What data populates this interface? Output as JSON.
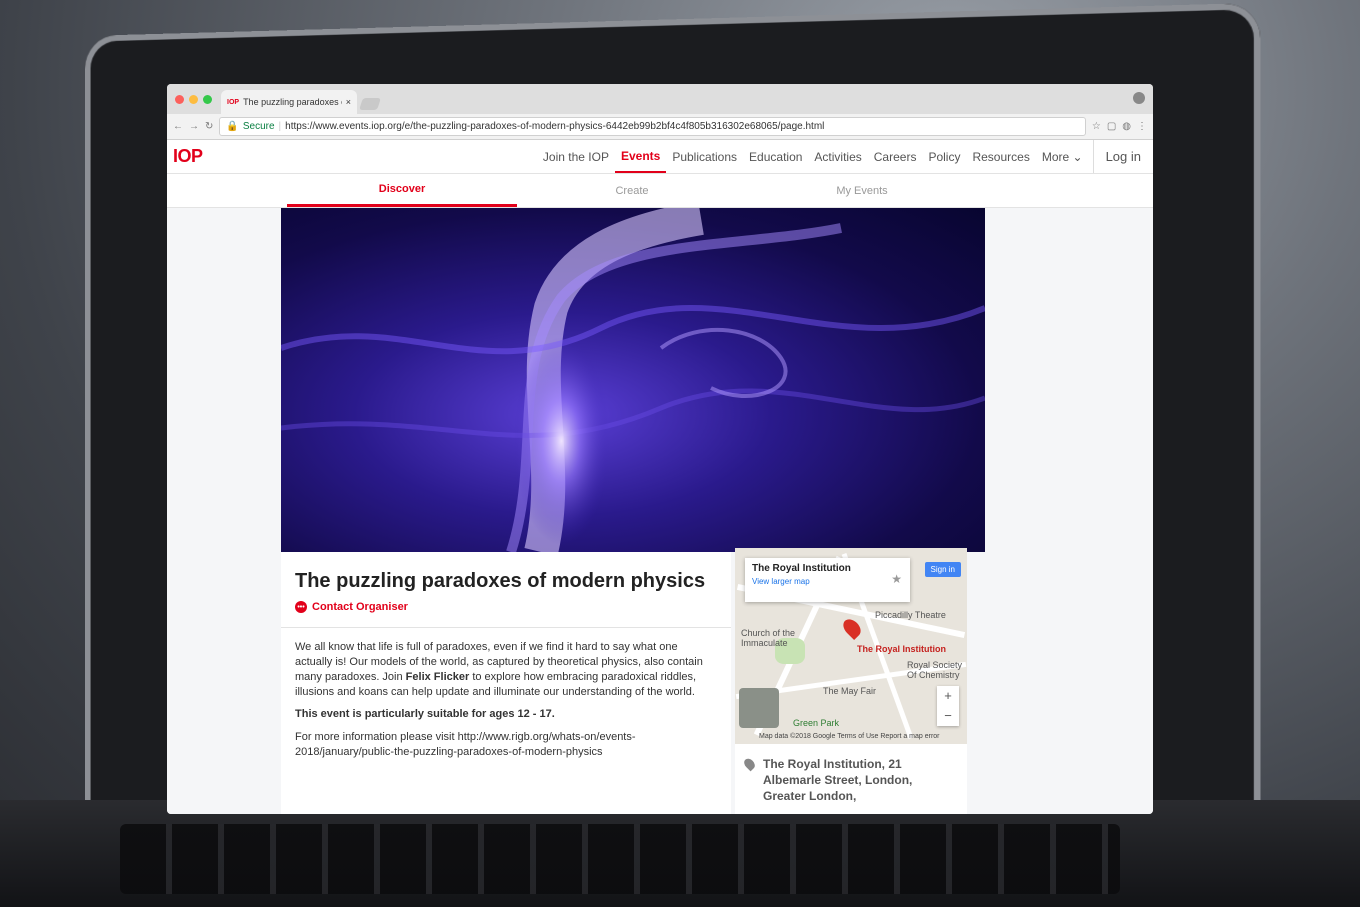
{
  "browser": {
    "tab_title": "The puzzling paradoxes of mo",
    "secure_label": "Secure",
    "url": "https://www.events.iop.org/e/the-puzzling-paradoxes-of-modern-physics-6442eb99b2bf4c4f805b316302e68065/page.html"
  },
  "header": {
    "logo": "IOP",
    "nav": [
      "Join the IOP",
      "Events",
      "Publications",
      "Education",
      "Activities",
      "Careers",
      "Policy",
      "Resources",
      "More"
    ],
    "login": "Log in"
  },
  "subnav": [
    "Discover",
    "Create",
    "My Events"
  ],
  "event": {
    "title": "The puzzling paradoxes of modern physics",
    "contact": "Contact Organiser",
    "para1_a": "We all know that life is full of paradoxes, even if we find it hard to say what one actually is! Our models of the world, as captured by theoretical physics, also contain many paradoxes. Join ",
    "para1_b": "Felix Flicker",
    "para1_c": " to explore how embracing paradoxical riddles, illusions and koans can help update and illuminate our understanding of the world.",
    "para2": "This event is particularly suitable for ages 12 - 17.",
    "para3": "For more information please visit http://www.rigb.org/whats-on/events-2018/january/public-the-puzzling-paradoxes-of-modern-physics"
  },
  "map": {
    "place": "The Royal Institution",
    "larger_map": "View larger map",
    "sign_in": "Sign in",
    "labels": [
      "Piccadilly Theatre",
      "Church of the Immaculate",
      "The Royal Institution",
      "Royal Society Of Chemistry",
      "The May Fair",
      "Green Park"
    ],
    "footer": "Map data ©2018 Google   Terms of Use   Report a map error",
    "zoom_in": "+",
    "zoom_out": "−"
  },
  "address": "The Royal Institution, 21 Albemarle Street, London, Greater London,"
}
